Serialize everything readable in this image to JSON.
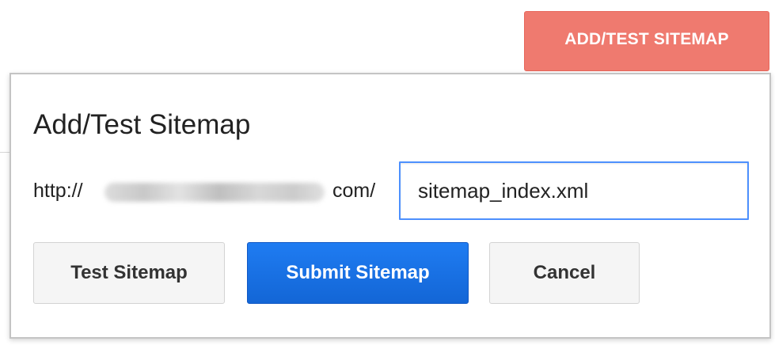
{
  "header": {
    "add_test_button_label": "ADD/TEST SITEMAP"
  },
  "dialog": {
    "title": "Add/Test Sitemap",
    "url_prefix": "http://",
    "url_suffix": "com/",
    "sitemap_path_value": "sitemap_index.xml",
    "buttons": {
      "test_label": "Test Sitemap",
      "submit_label": "Submit Sitemap",
      "cancel_label": "Cancel"
    }
  },
  "colors": {
    "top_button": "#ef7a6f",
    "submit_button": "#1a73e8",
    "input_focus_border": "#4d90fe"
  }
}
